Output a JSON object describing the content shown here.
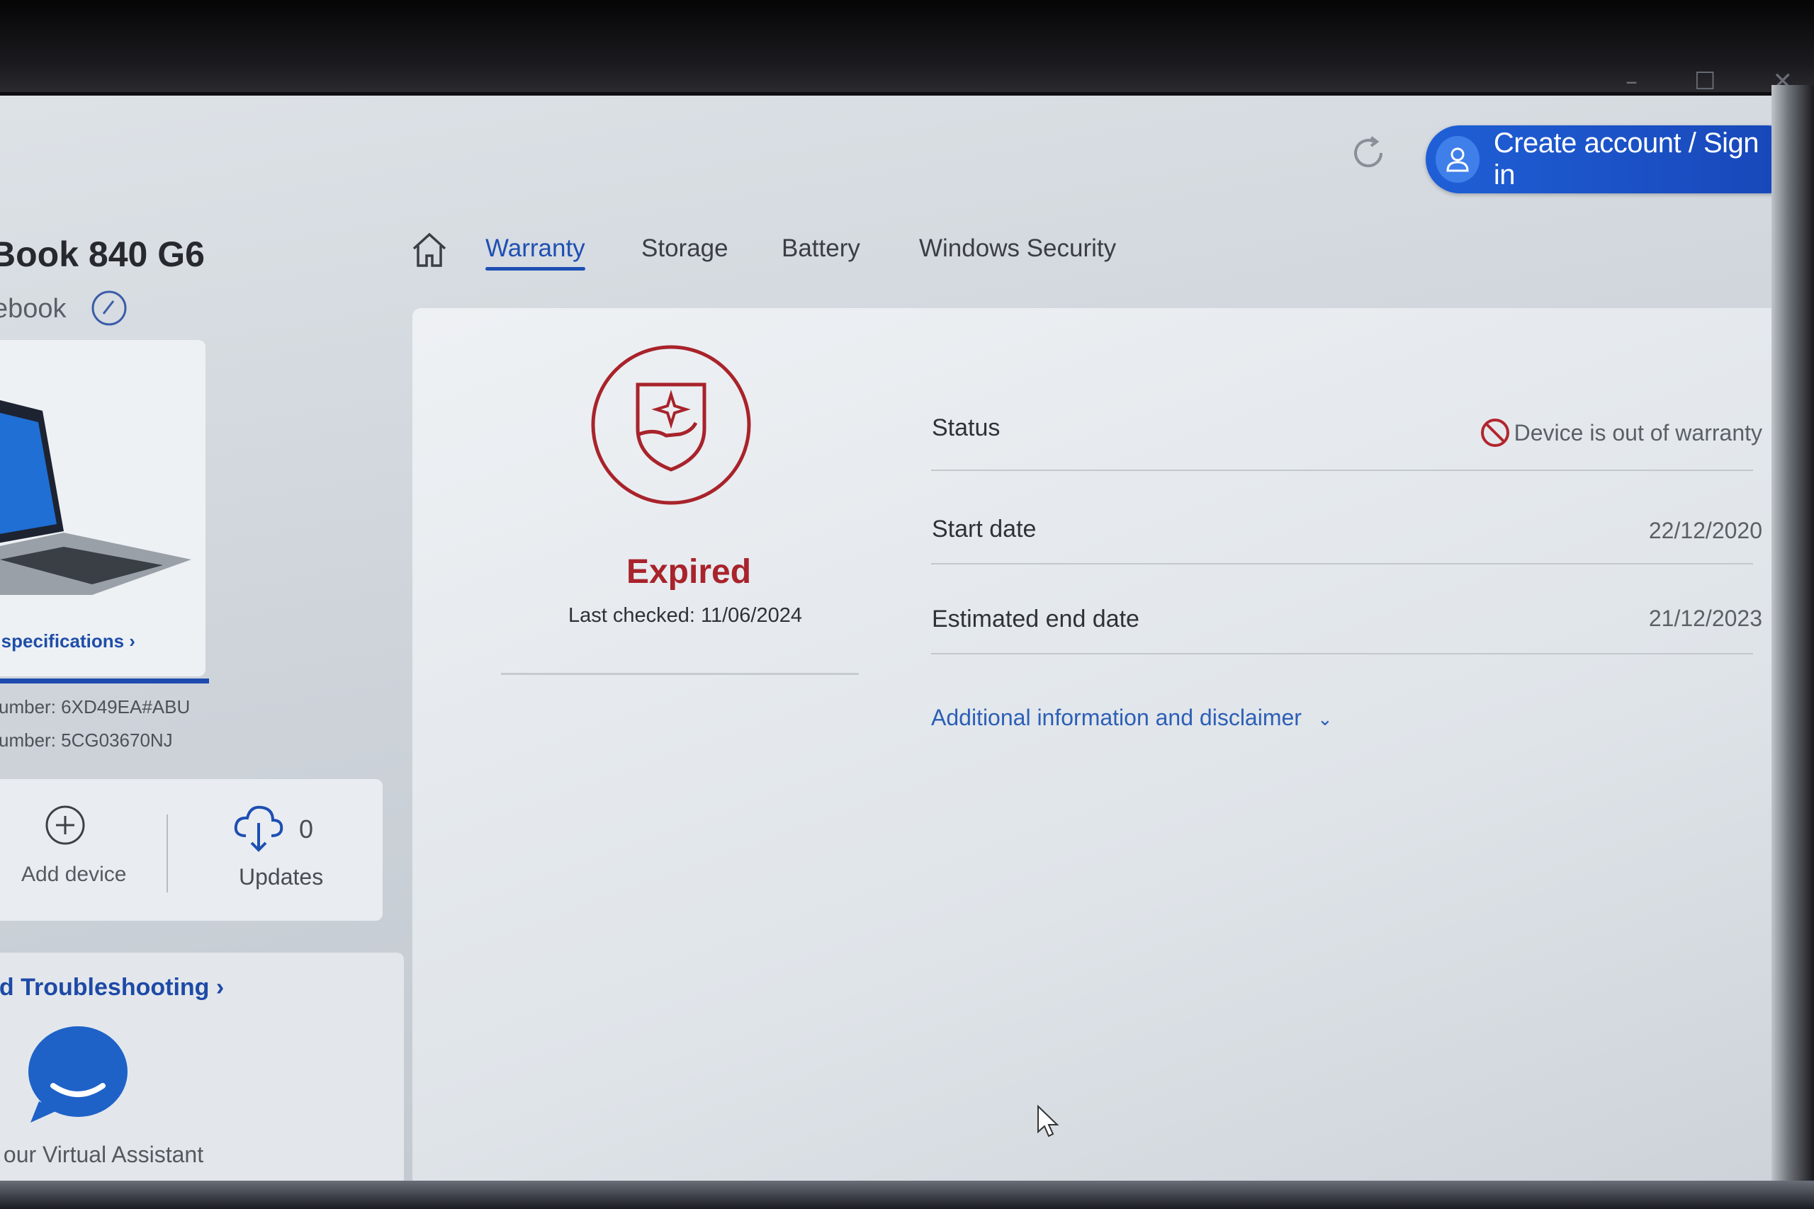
{
  "window": {
    "controls": [
      "–",
      "☐",
      "✕"
    ]
  },
  "header": {
    "refresh_icon": "refresh-icon",
    "signin_label": "Create account / Sign in"
  },
  "sidebar": {
    "device_name": "Book 840 G6",
    "device_type": "ebook",
    "spec_link": "e specifications ›",
    "product_number": "umber: 6XD49EA#ABU",
    "serial_number": "umber: 5CG03670NJ",
    "add_device_label": "Add device",
    "updates_label": "Updates",
    "updates_count": "0",
    "troubleshooting_link": "ed Troubleshooting ›",
    "assistant_label": "k our Virtual Assistant"
  },
  "tabs": [
    {
      "label": "Warranty",
      "active": true
    },
    {
      "label": "Storage",
      "active": false
    },
    {
      "label": "Battery",
      "active": false
    },
    {
      "label": "Windows Security",
      "active": false
    }
  ],
  "warranty": {
    "state": "Expired",
    "last_checked": "Last checked: 11/06/2024",
    "rows": {
      "status_label": "Status",
      "status_value": "Device is out of warranty",
      "start_label": "Start date",
      "start_value": "22/12/2020",
      "end_label": "Estimated end date",
      "end_value": "21/12/2023"
    },
    "disclaimer_link": "Additional information and disclaimer"
  },
  "colors": {
    "accent": "#1e4fb3",
    "expired_red": "#a8232b",
    "signin_button": "#1f5fd6"
  }
}
